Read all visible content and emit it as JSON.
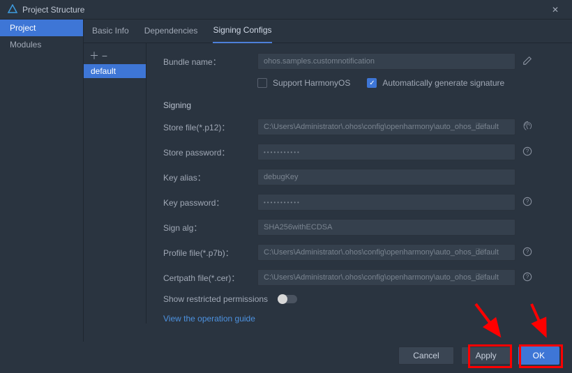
{
  "title": "Project Structure",
  "sidebar": {
    "items": [
      {
        "label": "Project",
        "active": true
      },
      {
        "label": "Modules",
        "active": false
      }
    ]
  },
  "tabs": [
    {
      "label": "Basic Info",
      "active": false
    },
    {
      "label": "Dependencies",
      "active": false
    },
    {
      "label": "Signing Configs",
      "active": true
    }
  ],
  "configList": {
    "toolbar": "＋   −",
    "items": [
      {
        "label": "default",
        "active": true
      }
    ]
  },
  "form": {
    "bundleName": {
      "label": "Bundle name：",
      "value": "ohos.samples.customnotification"
    },
    "supportHarmony": {
      "label": "Support HarmonyOS",
      "checked": false
    },
    "autoSign": {
      "label": "Automatically generate signature",
      "checked": true
    },
    "signingHeading": "Signing",
    "storeFile": {
      "label": "Store file(*.p12)：",
      "value": "C:\\Users\\Administrator\\.ohos\\config\\openharmony\\auto_ohos_default"
    },
    "storePassword": {
      "label": "Store password：",
      "value": "•••••••••••"
    },
    "keyAlias": {
      "label": "Key alias：",
      "value": "debugKey"
    },
    "keyPassword": {
      "label": "Key password：",
      "value": "•••••••••••"
    },
    "signAlg": {
      "label": "Sign alg：",
      "value": "SHA256withECDSA"
    },
    "profileFile": {
      "label": "Profile file(*.p7b)：",
      "value": "C:\\Users\\Administrator\\.ohos\\config\\openharmony\\auto_ohos_default"
    },
    "certpathFile": {
      "label": "Certpath file(*.cer)：",
      "value": "C:\\Users\\Administrator\\.ohos\\config\\openharmony\\auto_ohos_default"
    },
    "restricted": {
      "label": "Show restricted permissions",
      "checked": false
    },
    "guideLink": "View the operation guide"
  },
  "footer": {
    "cancel": "Cancel",
    "apply": "Apply",
    "ok": "OK"
  }
}
